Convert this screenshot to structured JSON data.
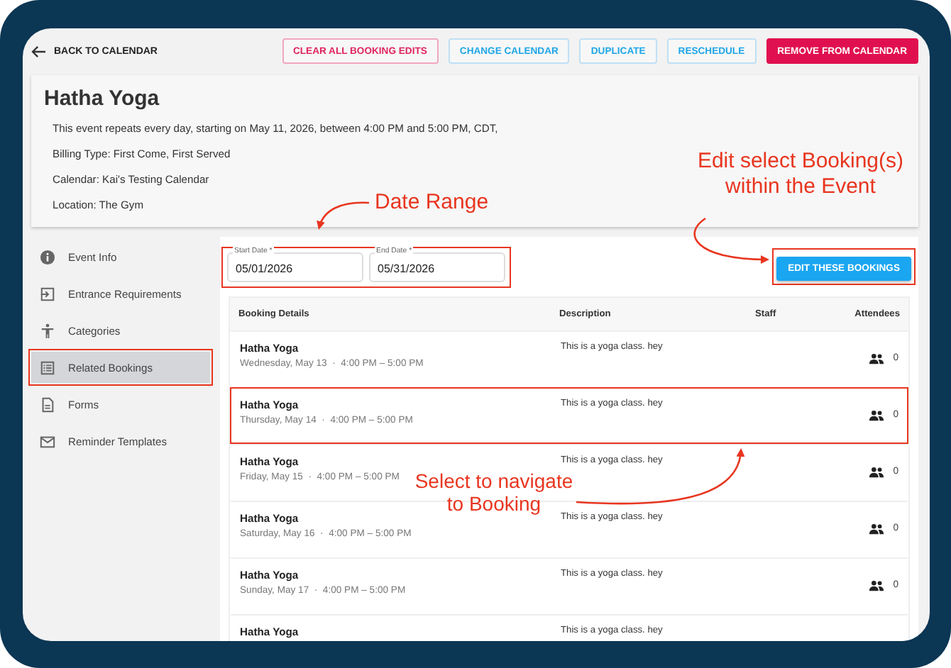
{
  "toolbar": {
    "back": "BACK TO CALENDAR",
    "buttons": [
      {
        "label": "CLEAR ALL BOOKING EDITS",
        "kind": "outline-danger"
      },
      {
        "label": "CHANGE CALENDAR",
        "kind": "outline"
      },
      {
        "label": "DUPLICATE",
        "kind": "outline"
      },
      {
        "label": "RESCHEDULE",
        "kind": "outline"
      },
      {
        "label": "REMOVE FROM CALENDAR",
        "kind": "danger"
      }
    ]
  },
  "event": {
    "title": "Hatha Yoga",
    "details": [
      "This event repeats every day, starting on May 11, 2026, between 4:00 PM and 5:00 PM, CDT,",
      "Billing Type: First Come, First Served",
      "Calendar: Kai's Testing Calendar",
      "Location: The Gym"
    ]
  },
  "sidebar": {
    "items": [
      {
        "label": "Event Info",
        "selected": false,
        "highlighted": false
      },
      {
        "label": "Entrance Requirements",
        "selected": false,
        "highlighted": false
      },
      {
        "label": "Categories",
        "selected": false,
        "highlighted": false
      },
      {
        "label": "Related Bookings",
        "selected": true,
        "highlighted": true
      },
      {
        "label": "Forms",
        "selected": false,
        "highlighted": false
      },
      {
        "label": "Reminder Templates",
        "selected": false,
        "highlighted": false
      }
    ]
  },
  "date_range": {
    "highlighted": true,
    "fields": [
      {
        "label": "Start Date *",
        "value": "05/01/2026"
      },
      {
        "label": "End Date *",
        "value": "05/31/2026"
      }
    ]
  },
  "edit_button": {
    "label": "EDIT THESE BOOKINGS",
    "highlighted": true
  },
  "table": {
    "columns": [
      "Booking Details",
      "Description",
      "Staff",
      "Attendees"
    ],
    "rows": [
      {
        "title": "Hatha Yoga",
        "subtitle": "Wednesday, May 13  ·  4:00 PM – 5:00 PM",
        "description": "This is a yoga class. hey",
        "attendees": "0"
      },
      {
        "title": "Hatha Yoga",
        "subtitle": "Thursday, May 14  ·  4:00 PM – 5:00 PM",
        "description": "This is a yoga class. hey",
        "attendees": "0",
        "highlighted": true
      },
      {
        "title": "Hatha Yoga",
        "subtitle": "Friday, May 15  ·  4:00 PM – 5:00 PM",
        "description": "This is a yoga class. hey",
        "attendees": "0"
      },
      {
        "title": "Hatha Yoga",
        "subtitle": "Saturday, May 16  ·  4:00 PM – 5:00 PM",
        "description": "This is a yoga class. hey",
        "attendees": "0"
      },
      {
        "title": "Hatha Yoga",
        "subtitle": "Sunday, May 17  ·  4:00 PM – 5:00 PM",
        "description": "This is a yoga class. hey",
        "attendees": "0"
      },
      {
        "title": "Hatha Yoga",
        "description": "This is a yoga class. hey"
      }
    ]
  },
  "annotations": [
    {
      "text": "Date Range"
    },
    {
      "text": "Edit select Booking(s) within the Event"
    },
    {
      "text": "Select to navigate to Booking"
    }
  ]
}
